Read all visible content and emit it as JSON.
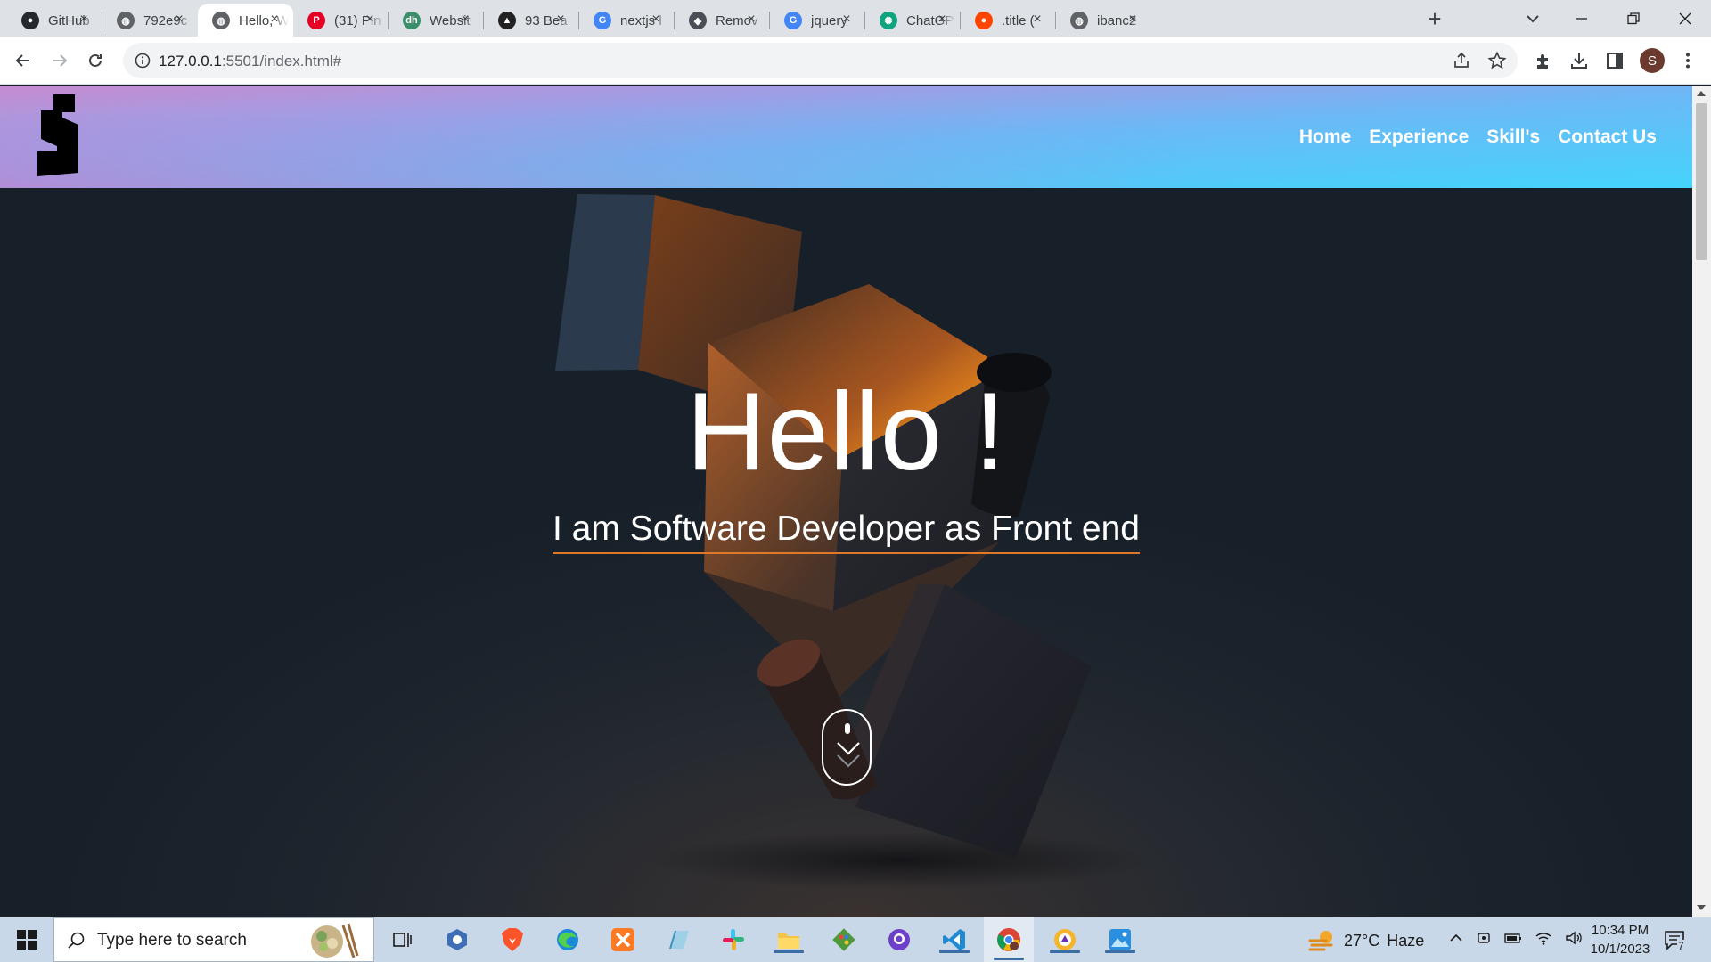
{
  "browser": {
    "tabs": [
      {
        "title": "GitHub",
        "icon": "github-icon",
        "color": "#24292f"
      },
      {
        "title": "792e9c",
        "icon": "globe-icon",
        "color": "#5f6368"
      },
      {
        "title": "Hello, W",
        "icon": "globe-icon",
        "color": "#5f6368",
        "active": true
      },
      {
        "title": "(31) Pin",
        "icon": "pinterest-icon",
        "color": "#e60023"
      },
      {
        "title": "Websit",
        "icon": "dh-icon",
        "color": "#3a8f6a"
      },
      {
        "title": "93 Bea",
        "icon": "cursor-app-icon",
        "color": "#222222"
      },
      {
        "title": "nextjs l",
        "icon": "google-icon",
        "color": "#4285f4"
      },
      {
        "title": "Remov",
        "icon": "remove-bg-icon",
        "color": "#4a4f57"
      },
      {
        "title": "jquery",
        "icon": "google-icon",
        "color": "#4285f4"
      },
      {
        "title": "ChatGP",
        "icon": "chatgpt-icon",
        "color": "#10a37f"
      },
      {
        "title": ".title (",
        "icon": "reddit-icon",
        "color": "#ff4500"
      },
      {
        "title": "ibanc2",
        "icon": "globe-icon",
        "color": "#5f6368"
      }
    ],
    "url_host": "127.0.0.1",
    "url_rest": ":5501/index.html#",
    "profile_initial": "S"
  },
  "site": {
    "nav": [
      "Home",
      "Experience",
      "Skill's",
      "Contact Us"
    ],
    "hero_title": "Hello !",
    "hero_subtitle": "I am Software Developer as Front end"
  },
  "taskbar": {
    "search_placeholder": "Type here to search",
    "weather_temp": "27°C",
    "weather_desc": "Haze",
    "time": "10:34 PM",
    "date": "10/1/2023",
    "notification_count": "7",
    "apps": [
      "task-view-icon",
      "app-icon",
      "brave-icon",
      "edge-icon",
      "xampp-icon",
      "notepad-icon",
      "slack-icon",
      "file-explorer-icon",
      "git-icon",
      "github-desktop-icon",
      "vscode-icon",
      "chrome-icon",
      "browser-icon",
      "photos-icon"
    ]
  },
  "colors": {
    "header_gradient_start": "#c78bd0",
    "header_gradient_end": "#44d4fb",
    "subtitle_underline": "#e0782a",
    "hero_background": "#1c232c"
  }
}
